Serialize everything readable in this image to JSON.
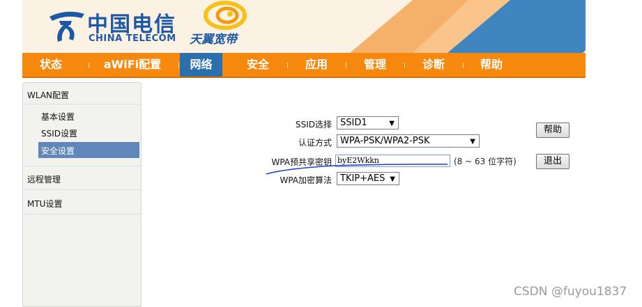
{
  "header": {
    "logo_cn": "中国电信",
    "logo_en": "CHINA TELECOM",
    "brand_text": "天翼宽带",
    "colors": {
      "orange": "#f7880e",
      "blue": "#2b6fad",
      "peach": "#f5b06a"
    }
  },
  "nav": {
    "items": [
      {
        "label": "状态"
      },
      {
        "label": "aWiFi配置"
      },
      {
        "label": "网络",
        "active": true
      },
      {
        "label": "安全"
      },
      {
        "label": "应用"
      },
      {
        "label": "管理"
      },
      {
        "label": "诊断"
      },
      {
        "label": "帮助"
      }
    ]
  },
  "sidebar": {
    "groups": [
      {
        "label": "WLAN配置",
        "subitems": [
          "基本设置",
          "SSID设置",
          "安全设置"
        ],
        "active_subitem": "安全设置"
      },
      {
        "label": "远程管理"
      },
      {
        "label": "MTU设置"
      }
    ]
  },
  "form": {
    "ssid_label": "SSID选择",
    "ssid_value": "SSID1",
    "auth_label": "认证方式",
    "auth_value": "WPA-PSK/WPA2-PSK",
    "psk_label": "WPA预共享密钥",
    "psk_value": "byE2Wkkn",
    "psk_hint": "(8 ~ 63 位字符)",
    "enc_label": "WPA加密算法",
    "enc_value": "TKIP+AES"
  },
  "buttons": {
    "help": "帮助",
    "logout": "退出"
  },
  "watermark": "CSDN @fuyou1837",
  "annotation_color": "#1a3fd0"
}
